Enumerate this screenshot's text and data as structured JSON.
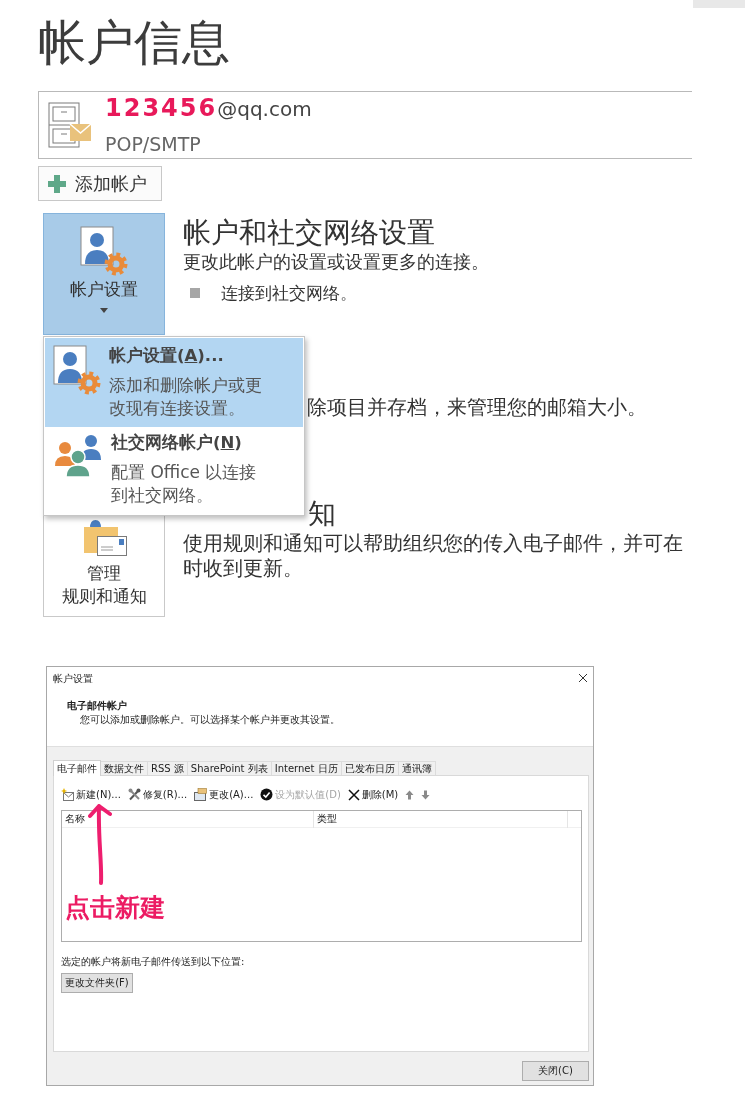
{
  "page": {
    "title": "帐户信息"
  },
  "account": {
    "email_user": "123456",
    "email_domain": "@qq.com",
    "type": "POP/SMTP"
  },
  "add_account_button": {
    "label": "添加帐户"
  },
  "account_settings_section": {
    "button": {
      "label_lines": [
        "帐户设置"
      ],
      "selected": true,
      "dropdown": true
    },
    "heading": "帐户和社交网络设置",
    "description": "更改此帐户的设置或设置更多的连接。",
    "bullets": [
      "连接到社交网络。"
    ]
  },
  "dropdown_menu": [
    {
      "kind": "account_settings",
      "selected": true,
      "title": {
        "before": "帐户设置(",
        "mnemonic": "A",
        "after": ")..."
      },
      "description_lines": [
        "添加和删除帐户或更",
        "改现有连接设置。"
      ]
    },
    {
      "kind": "social_network",
      "selected": false,
      "title": {
        "before": "社交网络帐户(",
        "mnemonic": "N",
        "after": ")"
      },
      "description_lines": [
        "配置 Office 以连接",
        "到社交网络。"
      ]
    }
  ],
  "cleanup_section": {
    "description": "除项目并存档，来管理您的邮箱大小。"
  },
  "rules_section": {
    "button": {
      "label_lines": [
        "管理",
        "规则和通知"
      ],
      "selected": false,
      "dropdown": false
    },
    "heading": "知",
    "description_lines": [
      "使用规则和通知可以帮助组织您的传入电子邮件，并可在",
      "时收到更新。"
    ]
  },
  "dialog": {
    "title": "帐户设置",
    "header_title": "电子邮件帐户",
    "header_description": "您可以添加或删除帐户。可以选择某个帐户并更改其设置。",
    "tabs": [
      {
        "label": "电子邮件",
        "selected": true
      },
      {
        "label": "数据文件",
        "selected": false
      },
      {
        "label": "RSS 源",
        "selected": false
      },
      {
        "label": "SharePoint 列表",
        "selected": false
      },
      {
        "label": "Internet 日历",
        "selected": false
      },
      {
        "label": "已发布日历",
        "selected": false
      },
      {
        "label": "通讯簿",
        "selected": false
      }
    ],
    "toolbar": [
      {
        "kind": "new",
        "label": "新建(N)...",
        "disabled": false
      },
      {
        "kind": "repair",
        "label": "修复(R)...",
        "disabled": false
      },
      {
        "kind": "change",
        "label": "更改(A)...",
        "disabled": false
      },
      {
        "kind": "set_default",
        "label": "设为默认值(D)",
        "disabled": true
      },
      {
        "kind": "remove",
        "label": "删除(M)",
        "disabled": false
      },
      {
        "kind": "move_up",
        "disabled": true
      },
      {
        "kind": "move_down",
        "disabled": true
      }
    ],
    "columns": [
      "名称",
      "类型"
    ],
    "annotation": "点击新建",
    "delivery_label": "选定的帐户将新电子邮件传送到以下位置:",
    "change_folder_button": "更改文件夹(F)",
    "close_button": "关闭(C)"
  }
}
